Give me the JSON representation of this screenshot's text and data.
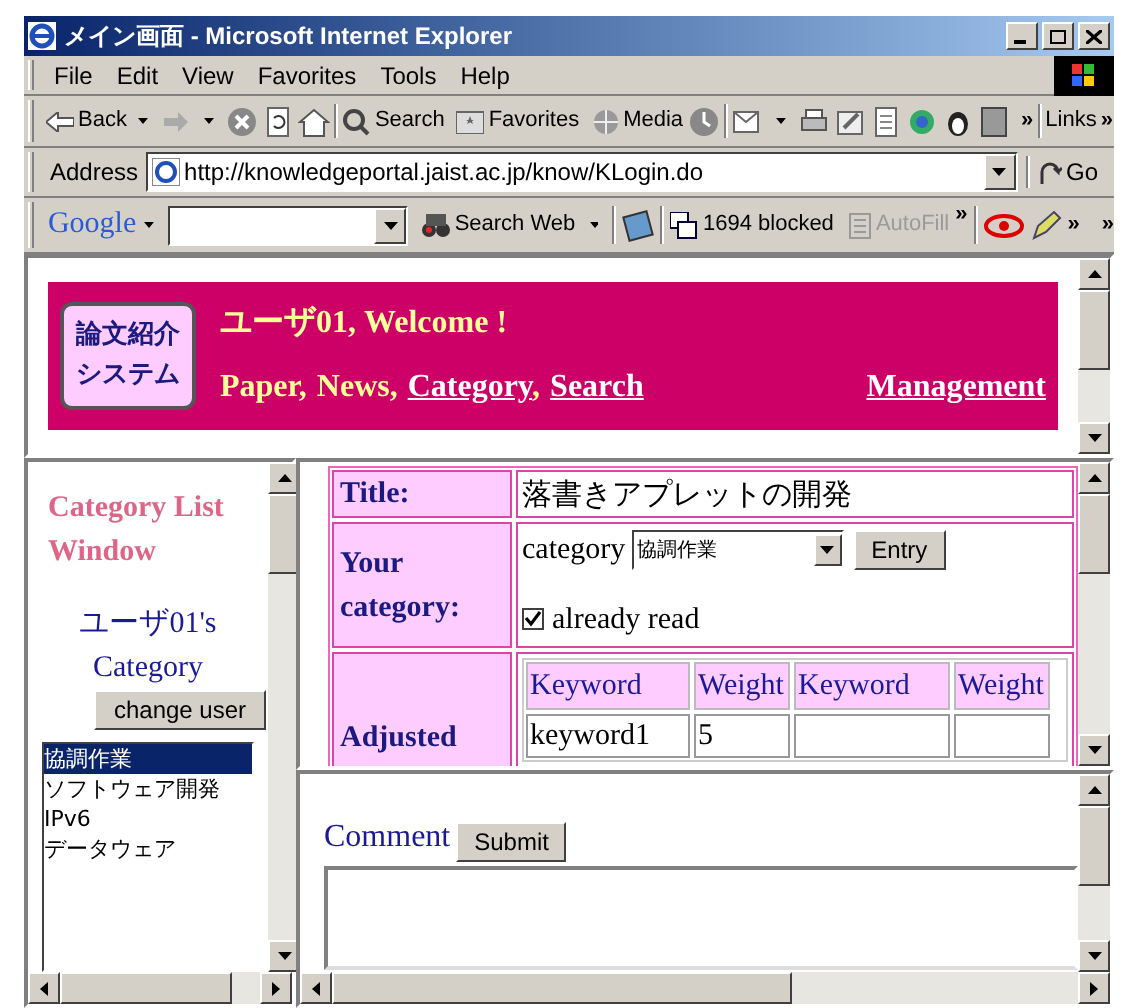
{
  "window": {
    "title": "メイン画面 - Microsoft Internet Explorer"
  },
  "menu": [
    "File",
    "Edit",
    "View",
    "Favorites",
    "Tools",
    "Help"
  ],
  "toolbar": {
    "back": "Back",
    "search": "Search",
    "favorites": "Favorites",
    "media": "Media",
    "more": "»",
    "links": "Links",
    "links_more": "»"
  },
  "address": {
    "label": "Address",
    "url": "http://knowledgeportal.jaist.ac.jp/know/KLogin.do",
    "go": "Go"
  },
  "google_bar": {
    "brand": "Google",
    "search_web": "Search Web",
    "more": "»",
    "blocked": "1694 blocked",
    "autofill": "AutoFill",
    "autofill_disabled": true,
    "more2": "»",
    "more3": "»"
  },
  "banner": {
    "logo": [
      "論文紹介",
      "システム"
    ],
    "welcome": "ユーザ01, Welcome !",
    "nav": [
      {
        "label": "Paper",
        "link": false,
        "sep": ","
      },
      {
        "label": "News",
        "link": false,
        "sep": ","
      },
      {
        "label": "Category",
        "link": true,
        "sep": ","
      },
      {
        "label": "Search",
        "link": true
      }
    ],
    "management": "Management"
  },
  "sidebar": {
    "heading": "Category List Window",
    "user_category": [
      "ユーザ01's",
      "Category"
    ],
    "change_user": "change user",
    "items": [
      {
        "label": "協調作業",
        "selected": true
      },
      {
        "label": "ソフトウェア開発",
        "selected": false
      },
      {
        "label": "IPv6",
        "selected": false
      },
      {
        "label": "データウェア",
        "selected": false
      }
    ]
  },
  "detail": {
    "title_label": "Title:",
    "title_value": "落書きアプレットの開発",
    "category_label": "Your category:",
    "category_text": "category",
    "category_select": "協調作業",
    "entry": "Entry",
    "already_read": {
      "label": "already read",
      "checked": true
    },
    "adjusted_label": "Adjusted",
    "keyword_columns": [
      "Keyword",
      "Weight",
      "Keyword",
      "Weight"
    ],
    "keyword_rows": [
      [
        "keyword1",
        "5",
        "",
        ""
      ]
    ]
  },
  "comment": {
    "label": "Comment",
    "submit": "Submit"
  }
}
